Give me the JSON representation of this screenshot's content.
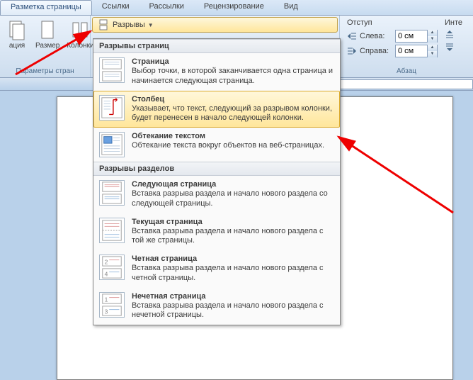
{
  "tabs": {
    "layout": "Разметка страницы",
    "links": "Ссылки",
    "mailings": "Рассылки",
    "review": "Рецензирование",
    "view": "Вид"
  },
  "ribbon": {
    "orientation": "ация",
    "size": "Размер",
    "columns": "Колонки",
    "breaks": "Разрывы",
    "group_page": "Параметры стран",
    "indent": {
      "title": "Отступ",
      "left_label": "Слева:",
      "right_label": "Справа:",
      "left_value": "0 см",
      "right_value": "0 см"
    },
    "spacing_title": "Инте",
    "paragraph_label": "Абзац"
  },
  "dropdown": {
    "section_page": "Разрывы страниц",
    "page": {
      "title": "Страница",
      "desc": "Выбор точки, в которой заканчивается одна страница и начинается следующая страница."
    },
    "column": {
      "title": "Столбец",
      "desc": "Указывает, что текст, следующий за разрывом колонки, будет перенесен в начало следующей колонки."
    },
    "wrap": {
      "title": "Обтекание текстом",
      "desc": "Обтекание текста вокруг объектов на веб-страницах."
    },
    "section_section": "Разрывы разделов",
    "nextpage": {
      "title": "Следующая страница",
      "desc": "Вставка разрыва раздела и начало нового раздела со следующей страницы."
    },
    "continuous": {
      "title": "Текущая страница",
      "desc": "Вставка разрыва раздела и начало нового раздела с той же страницы."
    },
    "even": {
      "title": "Четная страница",
      "desc": "Вставка разрыва раздела и начало нового раздела с четной страницы."
    },
    "odd": {
      "title": "Нечетная страница",
      "desc": "Вставка разрыва раздела и начало нового раздела с нечетной страницы."
    }
  }
}
